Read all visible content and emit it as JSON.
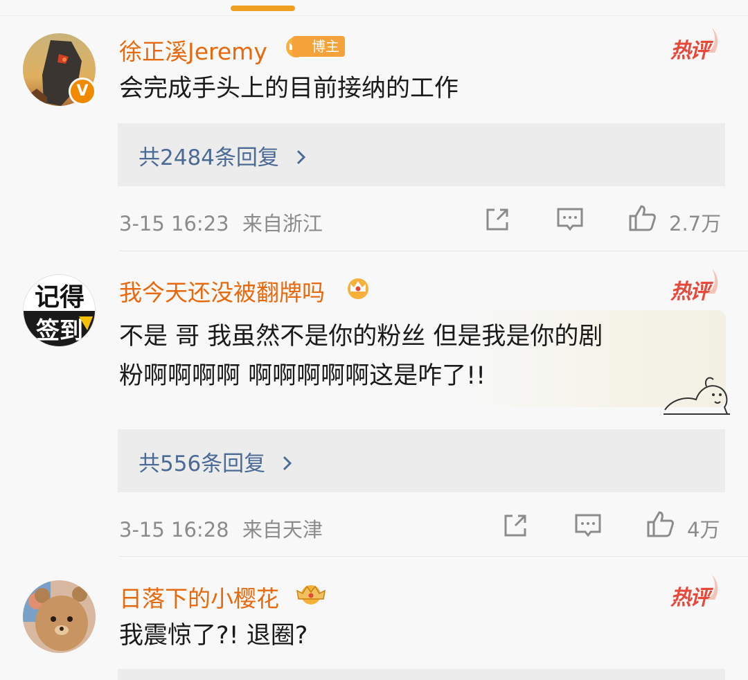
{
  "comments": [
    {
      "username": "徐正溪Jeremy",
      "badge": "博主",
      "hot_label": "热评",
      "content_lines": [
        "会完成手头上的目前接纳的工作"
      ],
      "replies": "共2484条回复",
      "time": "3-15 16:23",
      "location": "来自浙江",
      "likes": "2.7万",
      "verified_mark": "V"
    },
    {
      "username": "我今天还没被翻牌吗",
      "hot_label": "热评",
      "content_lines": [
        "不是 哥 我虽然不是你的粉丝 但是我是你的剧",
        "粉啊啊啊啊 啊啊啊啊啊这是咋了!!"
      ],
      "replies": "共556条回复",
      "time": "3-15 16:28",
      "location": "来自天津",
      "likes": "4万",
      "avatar_text": [
        "记得",
        "签到"
      ]
    },
    {
      "username": "日落下的小樱花",
      "hot_label": "热评",
      "content_lines": [
        "我震惊了?!  退圈?"
      ]
    }
  ],
  "icons": {
    "share": "share-icon",
    "comment": "comment-icon",
    "like": "thumbs-up-icon",
    "crown": "crown-icon",
    "chevron": "chevron-right-icon"
  },
  "colors": {
    "username": "#e8680c",
    "reply_link": "#4c6a96",
    "hot": "#e6483a",
    "accent": "#f0a020"
  }
}
